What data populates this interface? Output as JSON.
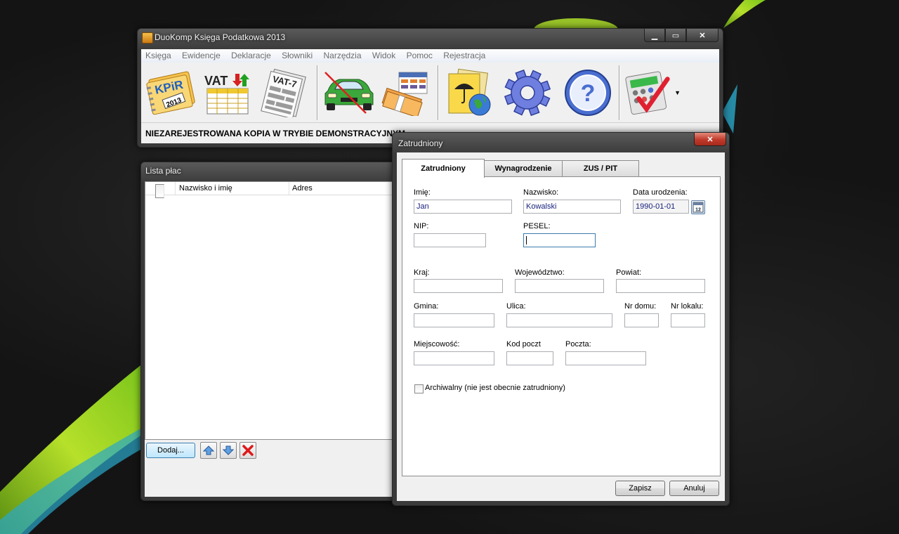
{
  "main_window": {
    "title": "DuoKomp Księga Podatkowa 2013",
    "menu": [
      "Księga",
      "Ewidencje",
      "Deklaracje",
      "Słowniki",
      "Narzędzia",
      "Widok",
      "Pomoc",
      "Rejestracja"
    ],
    "toolbar": [
      {
        "name": "kpir-icon",
        "label_a": "KPiR",
        "label_b": "2013"
      },
      {
        "name": "vat-register-icon",
        "label_a": "VAT"
      },
      {
        "name": "vat7-declaration-icon",
        "label_a": "VAT-7"
      },
      {
        "name": "car-icon"
      },
      {
        "name": "money-icon"
      },
      {
        "name": "documents-globe-icon"
      },
      {
        "name": "settings-gear-icon"
      },
      {
        "name": "help-icon"
      },
      {
        "name": "calculator-icon"
      }
    ],
    "status": "NIEZAREJESTROWANA KOPIA W TRYBIE DEMONSTRACYJNYM"
  },
  "list_window": {
    "title": "Lista płac",
    "columns": [
      "Nazwisko i imię",
      "Adres"
    ],
    "add_button": "Dodaj..."
  },
  "dialog": {
    "title": "Zatrudniony",
    "tabs": [
      "Zatrudniony",
      "Wynagrodzenie",
      "ZUS / PIT"
    ],
    "fields": {
      "imie": {
        "label": "Imię:",
        "value": "Jan"
      },
      "nazwisko": {
        "label": "Nazwisko:",
        "value": "Kowalski"
      },
      "data_urodzenia": {
        "label": "Data urodzenia:",
        "value": "1990-01-01"
      },
      "nip": {
        "label": "NIP:",
        "value": ""
      },
      "pesel": {
        "label": "PESEL:",
        "value": ""
      },
      "kraj": {
        "label": "Kraj:",
        "value": ""
      },
      "wojewodztwo": {
        "label": "Województwo:",
        "value": ""
      },
      "powiat": {
        "label": "Powiat:",
        "value": ""
      },
      "gmina": {
        "label": "Gmina:",
        "value": ""
      },
      "ulica": {
        "label": "Ulica:",
        "value": ""
      },
      "nr_domu": {
        "label": "Nr domu:",
        "value": ""
      },
      "nr_lokalu": {
        "label": "Nr lokalu:",
        "value": ""
      },
      "miejscowosc": {
        "label": "Miejscowość:",
        "value": ""
      },
      "kod_poczt": {
        "label": "Kod poczt",
        "value": ""
      },
      "poczta": {
        "label": "Poczta:",
        "value": ""
      }
    },
    "archiwalny_label": "Archiwalny (nie jest obecnie zatrudniony)",
    "archiwalny_checked": false,
    "calendar_icon_text": "12",
    "save_button": "Zapisz",
    "cancel_button": "Anuluj"
  },
  "colors": {
    "desktop": "#141414",
    "accent_green": "#9acd32",
    "field_text": "#1a237e",
    "close_red": "#c0392b"
  }
}
